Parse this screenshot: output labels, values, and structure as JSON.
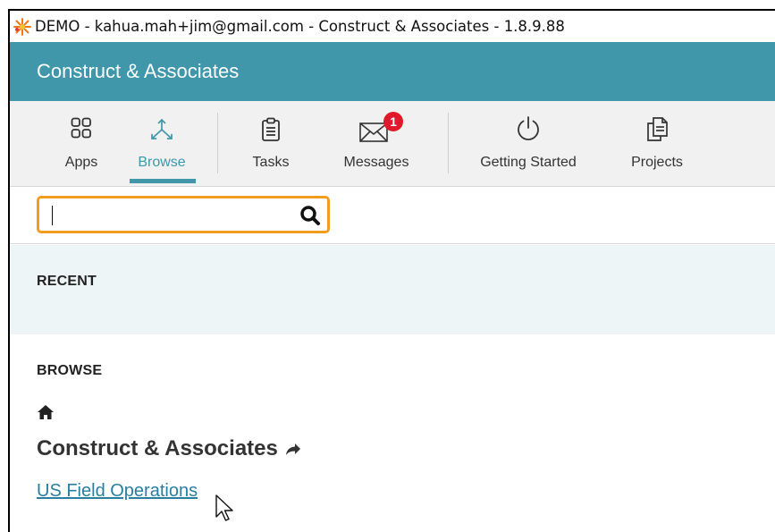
{
  "window": {
    "title": "DEMO - kahua.mah+jim@gmail.com - Construct & Associates - 1.8.9.88",
    "app_icon": "kahua-logo-icon"
  },
  "header": {
    "company": "Construct & Associates"
  },
  "toolbar": {
    "items": [
      {
        "label": "Apps",
        "icon": "apps-grid-icon"
      },
      {
        "label": "Browse",
        "icon": "browse-icon",
        "active": true
      },
      {
        "label": "Tasks",
        "icon": "clipboard-icon"
      },
      {
        "label": "Messages",
        "icon": "envelope-icon",
        "badge": "1"
      },
      {
        "label": "Getting Started",
        "icon": "power-icon"
      },
      {
        "label": "Projects",
        "icon": "documents-icon"
      }
    ],
    "active_color": "#3f97a9",
    "badge_color": "#e0192b"
  },
  "search": {
    "value": "",
    "placeholder": "",
    "border_color": "#f39c1f",
    "icon": "search-icon"
  },
  "recent": {
    "heading": "RECENT"
  },
  "browse": {
    "heading": "BROWSE",
    "home_icon": "home-icon",
    "current": "Construct & Associates",
    "share_icon": "share-arrow-icon",
    "children": [
      "US Field Operations"
    ]
  },
  "colors": {
    "header_bg": "#3f97a9",
    "toolbar_bg": "#f1f1f1",
    "recent_bg": "#eef5f7",
    "link": "#2a7fa0"
  }
}
